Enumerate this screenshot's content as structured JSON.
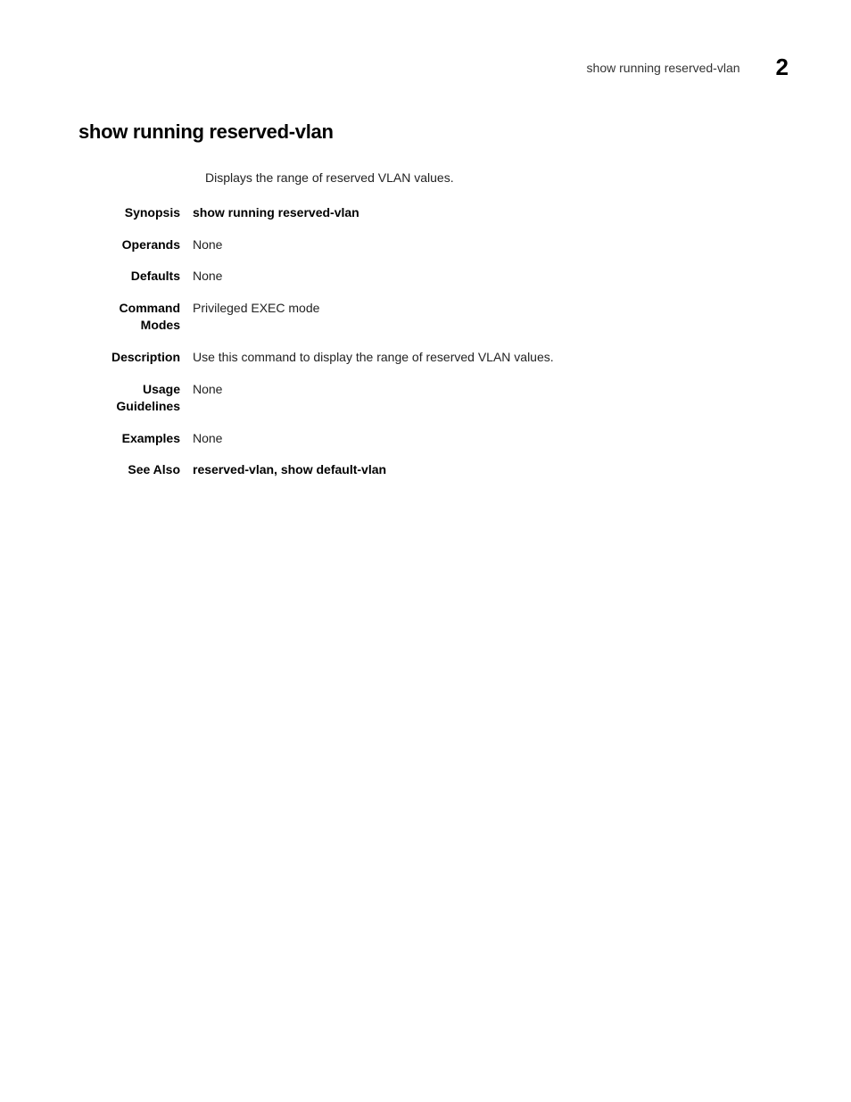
{
  "header": {
    "title": "show running reserved-vlan",
    "number": "2"
  },
  "main": {
    "title": "show running reserved-vlan",
    "intro": "Displays the range of reserved VLAN values.",
    "rows": [
      {
        "label": "Synopsis",
        "value": "show running reserved-vlan",
        "bold": true
      },
      {
        "label": "Operands",
        "value": "None",
        "bold": false
      },
      {
        "label": "Defaults",
        "value": "None",
        "bold": false
      },
      {
        "label": "Command Modes",
        "value": "Privileged EXEC mode",
        "bold": false
      },
      {
        "label": "Description",
        "value": "Use this command to display the range of reserved VLAN values.",
        "bold": false
      },
      {
        "label": "Usage Guidelines",
        "value": "None",
        "bold": false
      },
      {
        "label": "Examples",
        "value": "None",
        "bold": false
      },
      {
        "label": "See Also",
        "value": "reserved-vlan, show default-vlan",
        "bold": true
      }
    ]
  }
}
